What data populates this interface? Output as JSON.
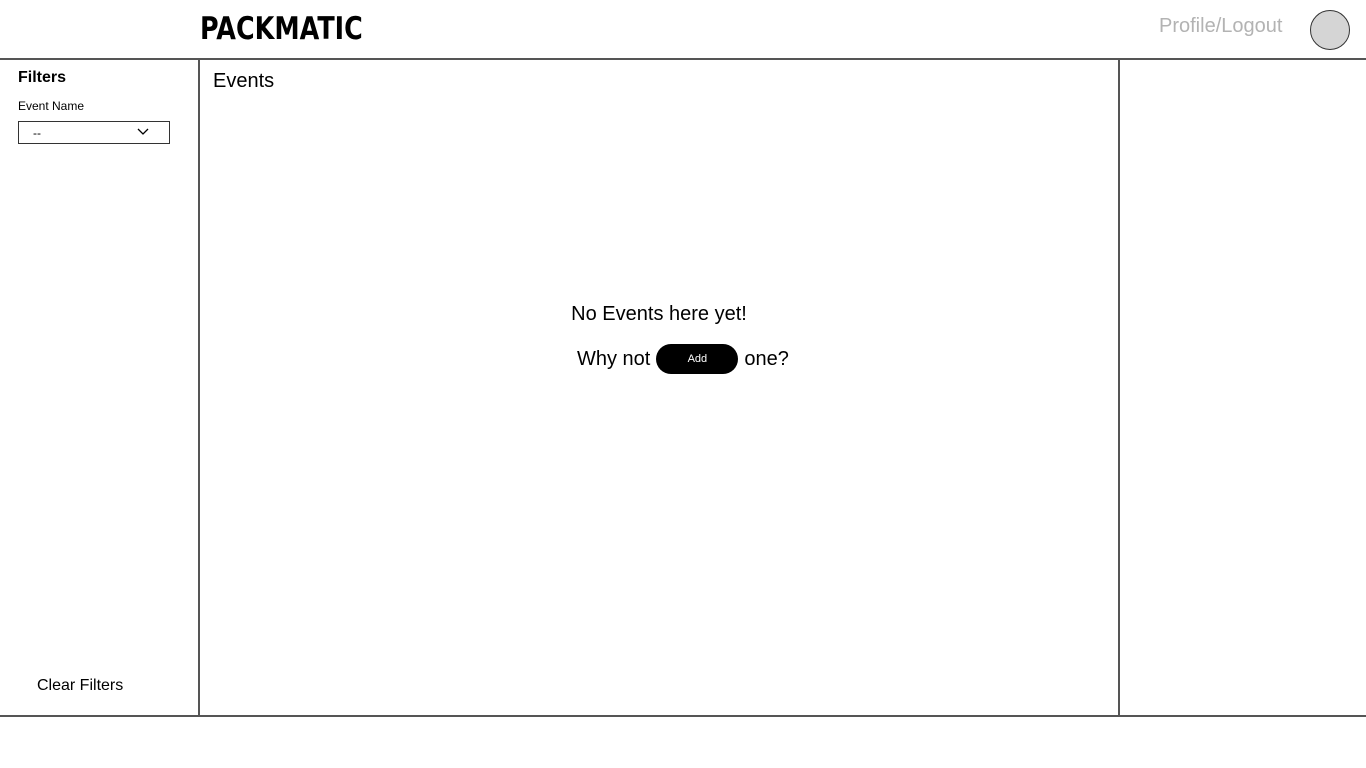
{
  "header": {
    "logo_text": "PACKMATIC",
    "profile_link": "Profile/Logout",
    "avatar_icon": "avatar-circle"
  },
  "sidebar": {
    "filters_title": "Filters",
    "event_name_label": "Event Name",
    "event_name_select": {
      "selected_value": "--",
      "icon": "chevron-down-icon"
    },
    "clear_filters_label": "Clear Filters"
  },
  "main": {
    "title": "Events",
    "empty_state": {
      "heading": "No Events here yet!",
      "prefix": "Why not",
      "add_button_label": "Add",
      "suffix": "one?"
    }
  },
  "colors": {
    "profile_link": "#b3b3b3",
    "avatar_fill": "#d5d5d5",
    "add_button_bg": "#000000",
    "add_button_text": "#ffffff",
    "divider": "#555555"
  }
}
